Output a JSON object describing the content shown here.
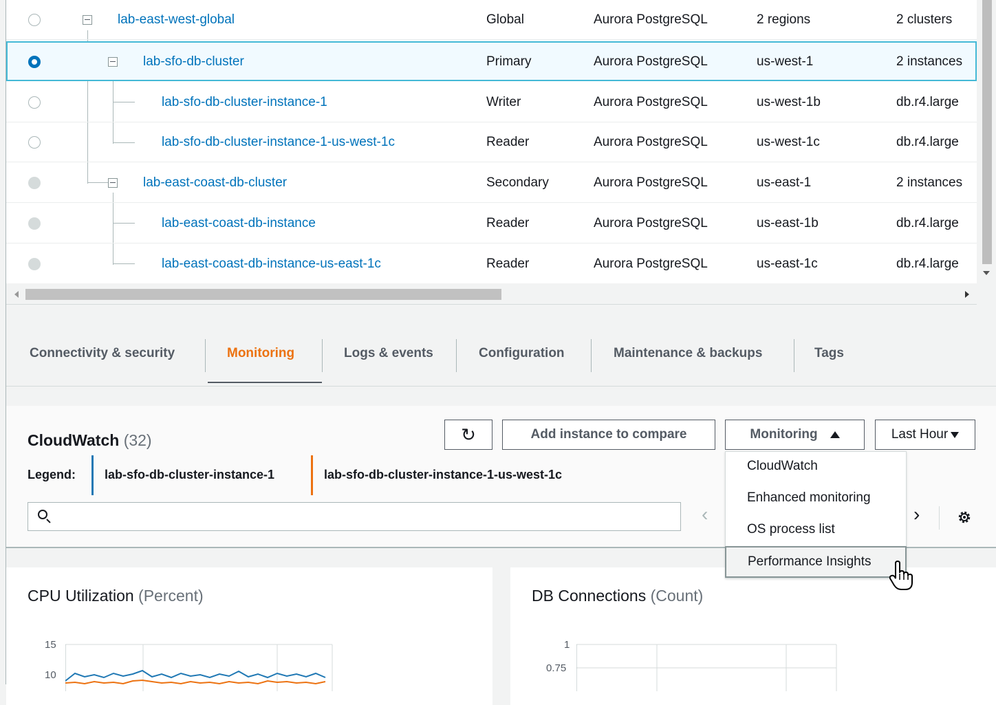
{
  "table": {
    "rows": [
      {
        "name": "lab-east-west-global",
        "role": "Global",
        "engine": "Aurora PostgreSQL",
        "region": "2 regions",
        "size": "2 clusters"
      },
      {
        "name": "lab-sfo-db-cluster",
        "role": "Primary",
        "engine": "Aurora PostgreSQL",
        "region": "us-west-1",
        "size": "2 instances"
      },
      {
        "name": "lab-sfo-db-cluster-instance-1",
        "role": "Writer",
        "engine": "Aurora PostgreSQL",
        "region": "us-west-1b",
        "size": "db.r4.large"
      },
      {
        "name": "lab-sfo-db-cluster-instance-1-us-west-1c",
        "role": "Reader",
        "engine": "Aurora PostgreSQL",
        "region": "us-west-1c",
        "size": "db.r4.large"
      },
      {
        "name": "lab-east-coast-db-cluster",
        "role": "Secondary",
        "engine": "Aurora PostgreSQL",
        "region": "us-east-1",
        "size": "2 instances"
      },
      {
        "name": "lab-east-coast-db-instance",
        "role": "Reader",
        "engine": "Aurora PostgreSQL",
        "region": "us-east-1b",
        "size": "db.r4.large"
      },
      {
        "name": "lab-east-coast-db-instance-us-east-1c",
        "role": "Reader",
        "engine": "Aurora PostgreSQL",
        "region": "us-east-1c",
        "size": "db.r4.large"
      }
    ]
  },
  "tabs": [
    {
      "label": "Connectivity & security"
    },
    {
      "label": "Monitoring"
    },
    {
      "label": "Logs & events"
    },
    {
      "label": "Configuration"
    },
    {
      "label": "Maintenance & backups"
    },
    {
      "label": "Tags"
    }
  ],
  "cloudwatch": {
    "title": "CloudWatch",
    "count": "(32)",
    "legend_label": "Legend:",
    "legend": [
      {
        "name": "lab-sfo-db-cluster-instance-1",
        "color": "#1f78b4"
      },
      {
        "name": "lab-sfo-db-cluster-instance-1-us-west-1c",
        "color": "#ec7211"
      }
    ],
    "refresh_icon": "↻",
    "add_compare_label": "Add instance to compare",
    "monitoring_label": "Monitoring",
    "time_label": "Last Hour",
    "search_placeholder": "",
    "prev_icon": "‹",
    "next_icon": "›"
  },
  "dropdown": {
    "items": [
      "CloudWatch",
      "Enhanced monitoring",
      "OS process list",
      "Performance Insights"
    ]
  },
  "charts": [
    {
      "title": "CPU Utilization",
      "unit": "(Percent)",
      "ticks": [
        "15",
        "10"
      ]
    },
    {
      "title": "DB Connections",
      "unit": "(Count)",
      "ticks": [
        "1",
        "0.75"
      ]
    }
  ]
}
